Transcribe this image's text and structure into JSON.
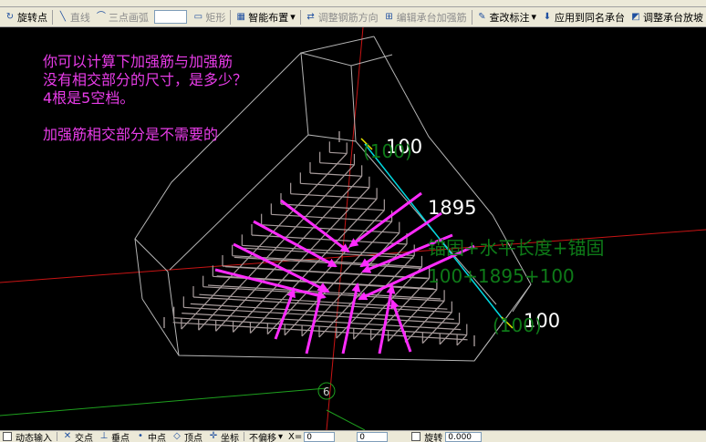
{
  "toolbar_main": {
    "items": [
      {
        "label": "旋转点",
        "icon": "rotate-point-icon",
        "disabled": false
      },
      {
        "label": "直线",
        "icon": "line-icon",
        "disabled": true
      },
      {
        "label": "三点画弧",
        "icon": "arc-icon",
        "disabled": true
      },
      {
        "label": "矩形",
        "icon": "rectangle-icon",
        "disabled": true
      },
      {
        "label": "智能布置",
        "icon": "smart-layout-icon",
        "disabled": false
      },
      {
        "label": "调整钢筋方向",
        "icon": "rebar-direction-icon",
        "disabled": true
      },
      {
        "label": "编辑承台加强筋",
        "icon": "edit-reinforcement-icon",
        "disabled": true
      },
      {
        "label": "查改标注",
        "icon": "edit-annotation-icon",
        "disabled": false
      },
      {
        "label": "应用到同名承台",
        "icon": "apply-same-name-icon",
        "disabled": false
      },
      {
        "label": "调整承台放坡",
        "icon": "adjust-slope-icon",
        "disabled": false
      }
    ]
  },
  "toolbar_bottom": {
    "dynamic_input": "动态输入",
    "snap": [
      "交点",
      "垂点",
      "中点",
      "顶点",
      "坐标"
    ],
    "offset_mode": "不偏移",
    "x_label": "X=",
    "x_value": "0",
    "y_value": "0",
    "rotate_label": "旋转",
    "rotate_value": "0.000"
  },
  "annotations": {
    "question_lines": [
      "你可以计算下加强筋与加强筋",
      "没有相交部分的尺寸，是多少？",
      "4根是5空档。"
    ],
    "note": "加强筋相交部分是不需要的",
    "dim_top": "100",
    "dim_top_sub": "(100)",
    "dim_mid": "1895",
    "formula_text": "锚固+水平长度+锚固",
    "formula_values": "100+1895+100",
    "dim_bottom": "100",
    "dim_bottom_sub": "(100)",
    "axis_marker": "6"
  },
  "colors": {
    "cap_outline": "#b4b4b4",
    "rebar": "#a89c9c",
    "arrows": "#ff2bff",
    "dimension_line": "#00d8e0",
    "axis_red": "#d01818",
    "axis_green": "#1ea01e"
  }
}
